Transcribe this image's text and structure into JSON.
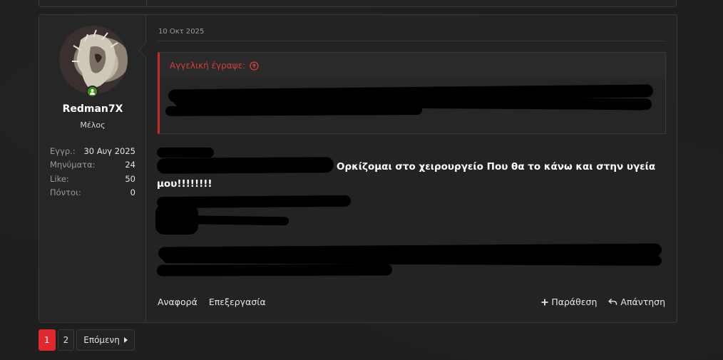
{
  "post": {
    "date": "10 Οκτ 2025",
    "user": {
      "name": "Redman7X",
      "role": "Μέλος",
      "stats": [
        {
          "label": "Εγγρ.:",
          "value": "30 Αυγ 2025"
        },
        {
          "label": "Μηνύματα:",
          "value": "24"
        },
        {
          "label": "Like:",
          "value": "50"
        },
        {
          "label": "Πόντοι:",
          "value": "0"
        }
      ]
    },
    "quote": {
      "author_label": "Αγγελική έγραψε:"
    },
    "message_line1": "Ορκίζομαι στο χειρουργείο Που θα το κάνω και στην υγεία",
    "message_line2": "μου!!!!!!!!",
    "actions": {
      "report": "Αναφορά",
      "edit": "Επεξεργασία",
      "quote": "Παράθεση",
      "reply": "Απάντηση"
    }
  },
  "pagination": {
    "pages": [
      "1",
      "2"
    ],
    "current": "1",
    "next_label": "Επόμενη"
  },
  "colors": {
    "accent": "#e0292f",
    "quote_red": "#d63d3d",
    "online": "#3f8f1f"
  }
}
